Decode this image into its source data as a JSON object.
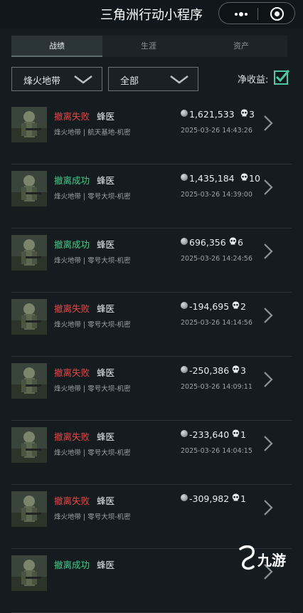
{
  "header": {
    "title": "三角洲行动小程序"
  },
  "tabs": [
    {
      "label": "战绩",
      "active": true
    },
    {
      "label": "生涯",
      "active": false
    },
    {
      "label": "资产",
      "active": false
    }
  ],
  "filters": {
    "mode": "烽火地带",
    "scope": "全部",
    "net_profit_label": "净收益:",
    "net_profit_checked": true
  },
  "records": [
    {
      "status": "撤离失败",
      "status_type": "fail",
      "operator": "蜂医",
      "map": "烽火地带 | 航天基地-机密",
      "value": "1,621,533",
      "kills": "3",
      "time": "2025-03-26 14:43:26"
    },
    {
      "status": "撤离成功",
      "status_type": "success",
      "operator": "蜂医",
      "map": "烽火地带 | 零号大坝-机密",
      "value": "1,435,184",
      "kills": "10",
      "time": "2025-03-26 14:39:00"
    },
    {
      "status": "撤离成功",
      "status_type": "success",
      "operator": "蜂医",
      "map": "烽火地带 | 零号大坝-机密",
      "value": "696,356",
      "kills": "6",
      "time": "2025-03-26 14:24:56"
    },
    {
      "status": "撤离失败",
      "status_type": "fail",
      "operator": "蜂医",
      "map": "烽火地带 | 零号大坝-机密",
      "value": "-194,695",
      "kills": "2",
      "time": "2025-03-26 14:14:56"
    },
    {
      "status": "撤离失败",
      "status_type": "fail",
      "operator": "蜂医",
      "map": "烽火地带 | 零号大坝-机密",
      "value": "-250,386",
      "kills": "3",
      "time": "2025-03-26 14:09:11"
    },
    {
      "status": "撤离失败",
      "status_type": "fail",
      "operator": "蜂医",
      "map": "烽火地带 | 零号大坝-机密",
      "value": "-233,640",
      "kills": "1",
      "time": "2025-03-26 14:04:15"
    },
    {
      "status": "撤离失败",
      "status_type": "fail",
      "operator": "蜂医",
      "map": "烽火地带 | 零号大坝-机密",
      "value": "-309,982",
      "kills": "1",
      "time": ""
    },
    {
      "status": "撤离成功",
      "status_type": "success",
      "operator": "蜂医",
      "map": "",
      "value": "",
      "kills": "",
      "time": ""
    }
  ],
  "watermark": {
    "text": "九游"
  },
  "colors": {
    "fail": "#e3484a",
    "success": "#45c88a",
    "accent": "#4fc7a4",
    "background": "#151c20"
  }
}
